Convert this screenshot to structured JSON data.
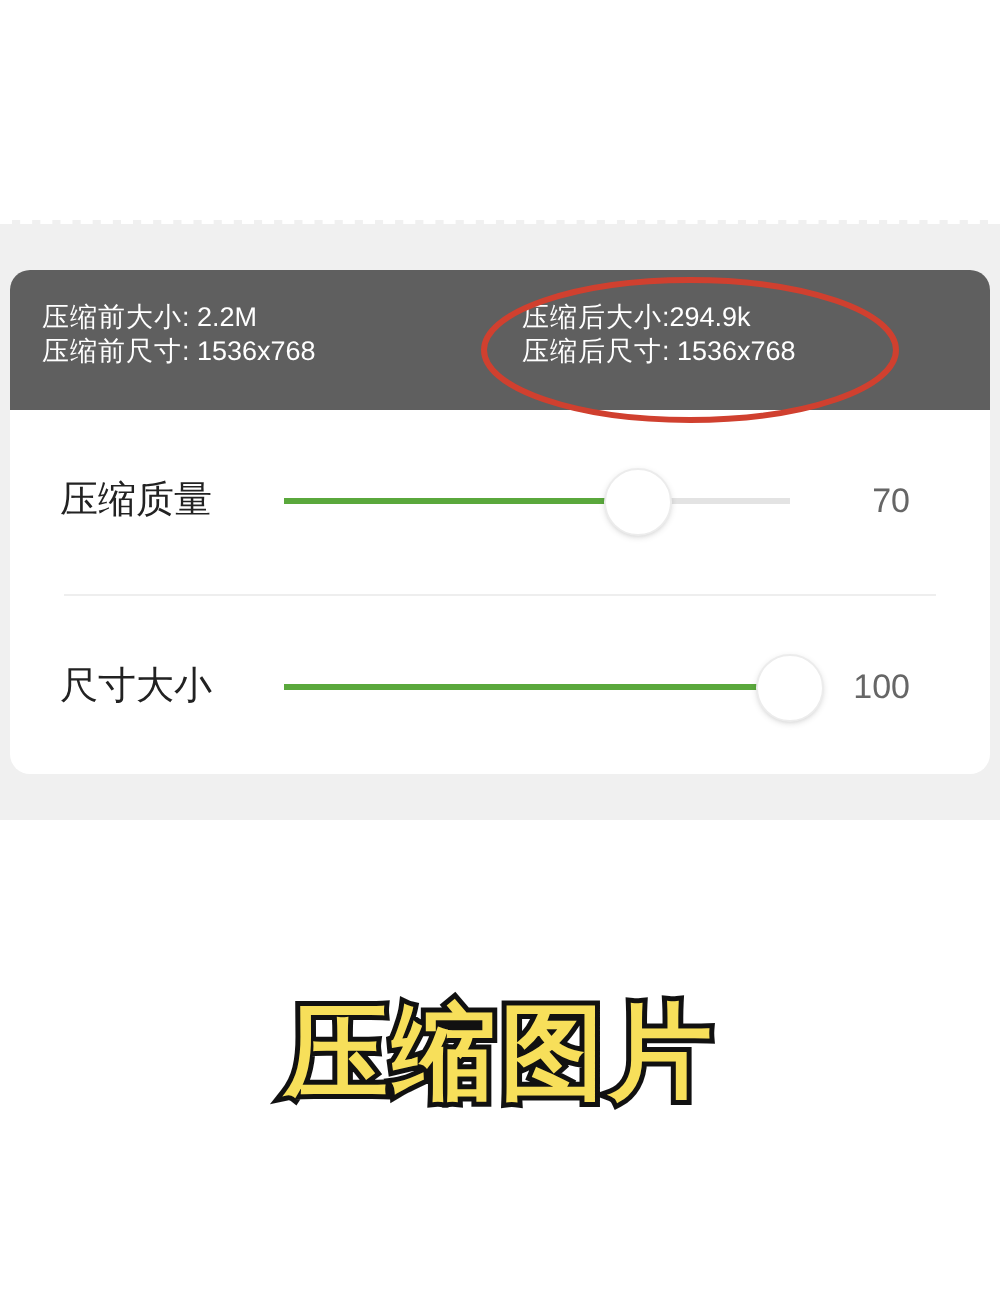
{
  "info": {
    "before": [
      "压缩前大小: 2.2M",
      "压缩前尺寸: 1536x768"
    ],
    "after": [
      "压缩后大小:294.9k",
      "压缩后尺寸: 1536x768"
    ]
  },
  "sliders": [
    {
      "label": "压缩质量",
      "level": 0.7,
      "reading": "70"
    },
    {
      "label": "尺寸大小",
      "level": 1.0,
      "reading": "100"
    }
  ],
  "caption": "压缩图片"
}
